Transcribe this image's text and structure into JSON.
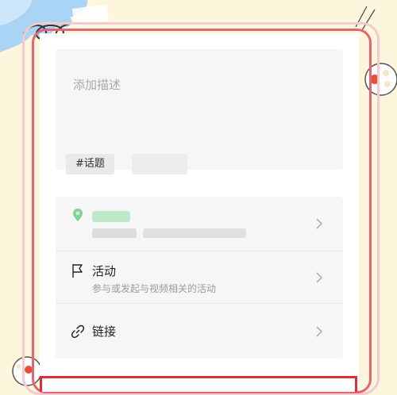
{
  "description": {
    "placeholder": "添加描述"
  },
  "tags": {
    "topic_label": "#话题"
  },
  "options": {
    "activity": {
      "title": "活动",
      "subtitle": "参与或发起与视频相关的活动"
    },
    "link": {
      "title": "链接"
    }
  },
  "icons": {
    "location": "location-pin-icon",
    "activity": "flag-icon",
    "link": "link-icon",
    "chevron": "chevron-right-icon"
  },
  "colors": {
    "page_background": "#fdf6dc",
    "frame_pink": "#f4c9cf",
    "frame_red": "#e06673",
    "card_background": "#f6f6f6",
    "location_green": "#55c26a",
    "decor_blue": "#a9d4f5"
  }
}
